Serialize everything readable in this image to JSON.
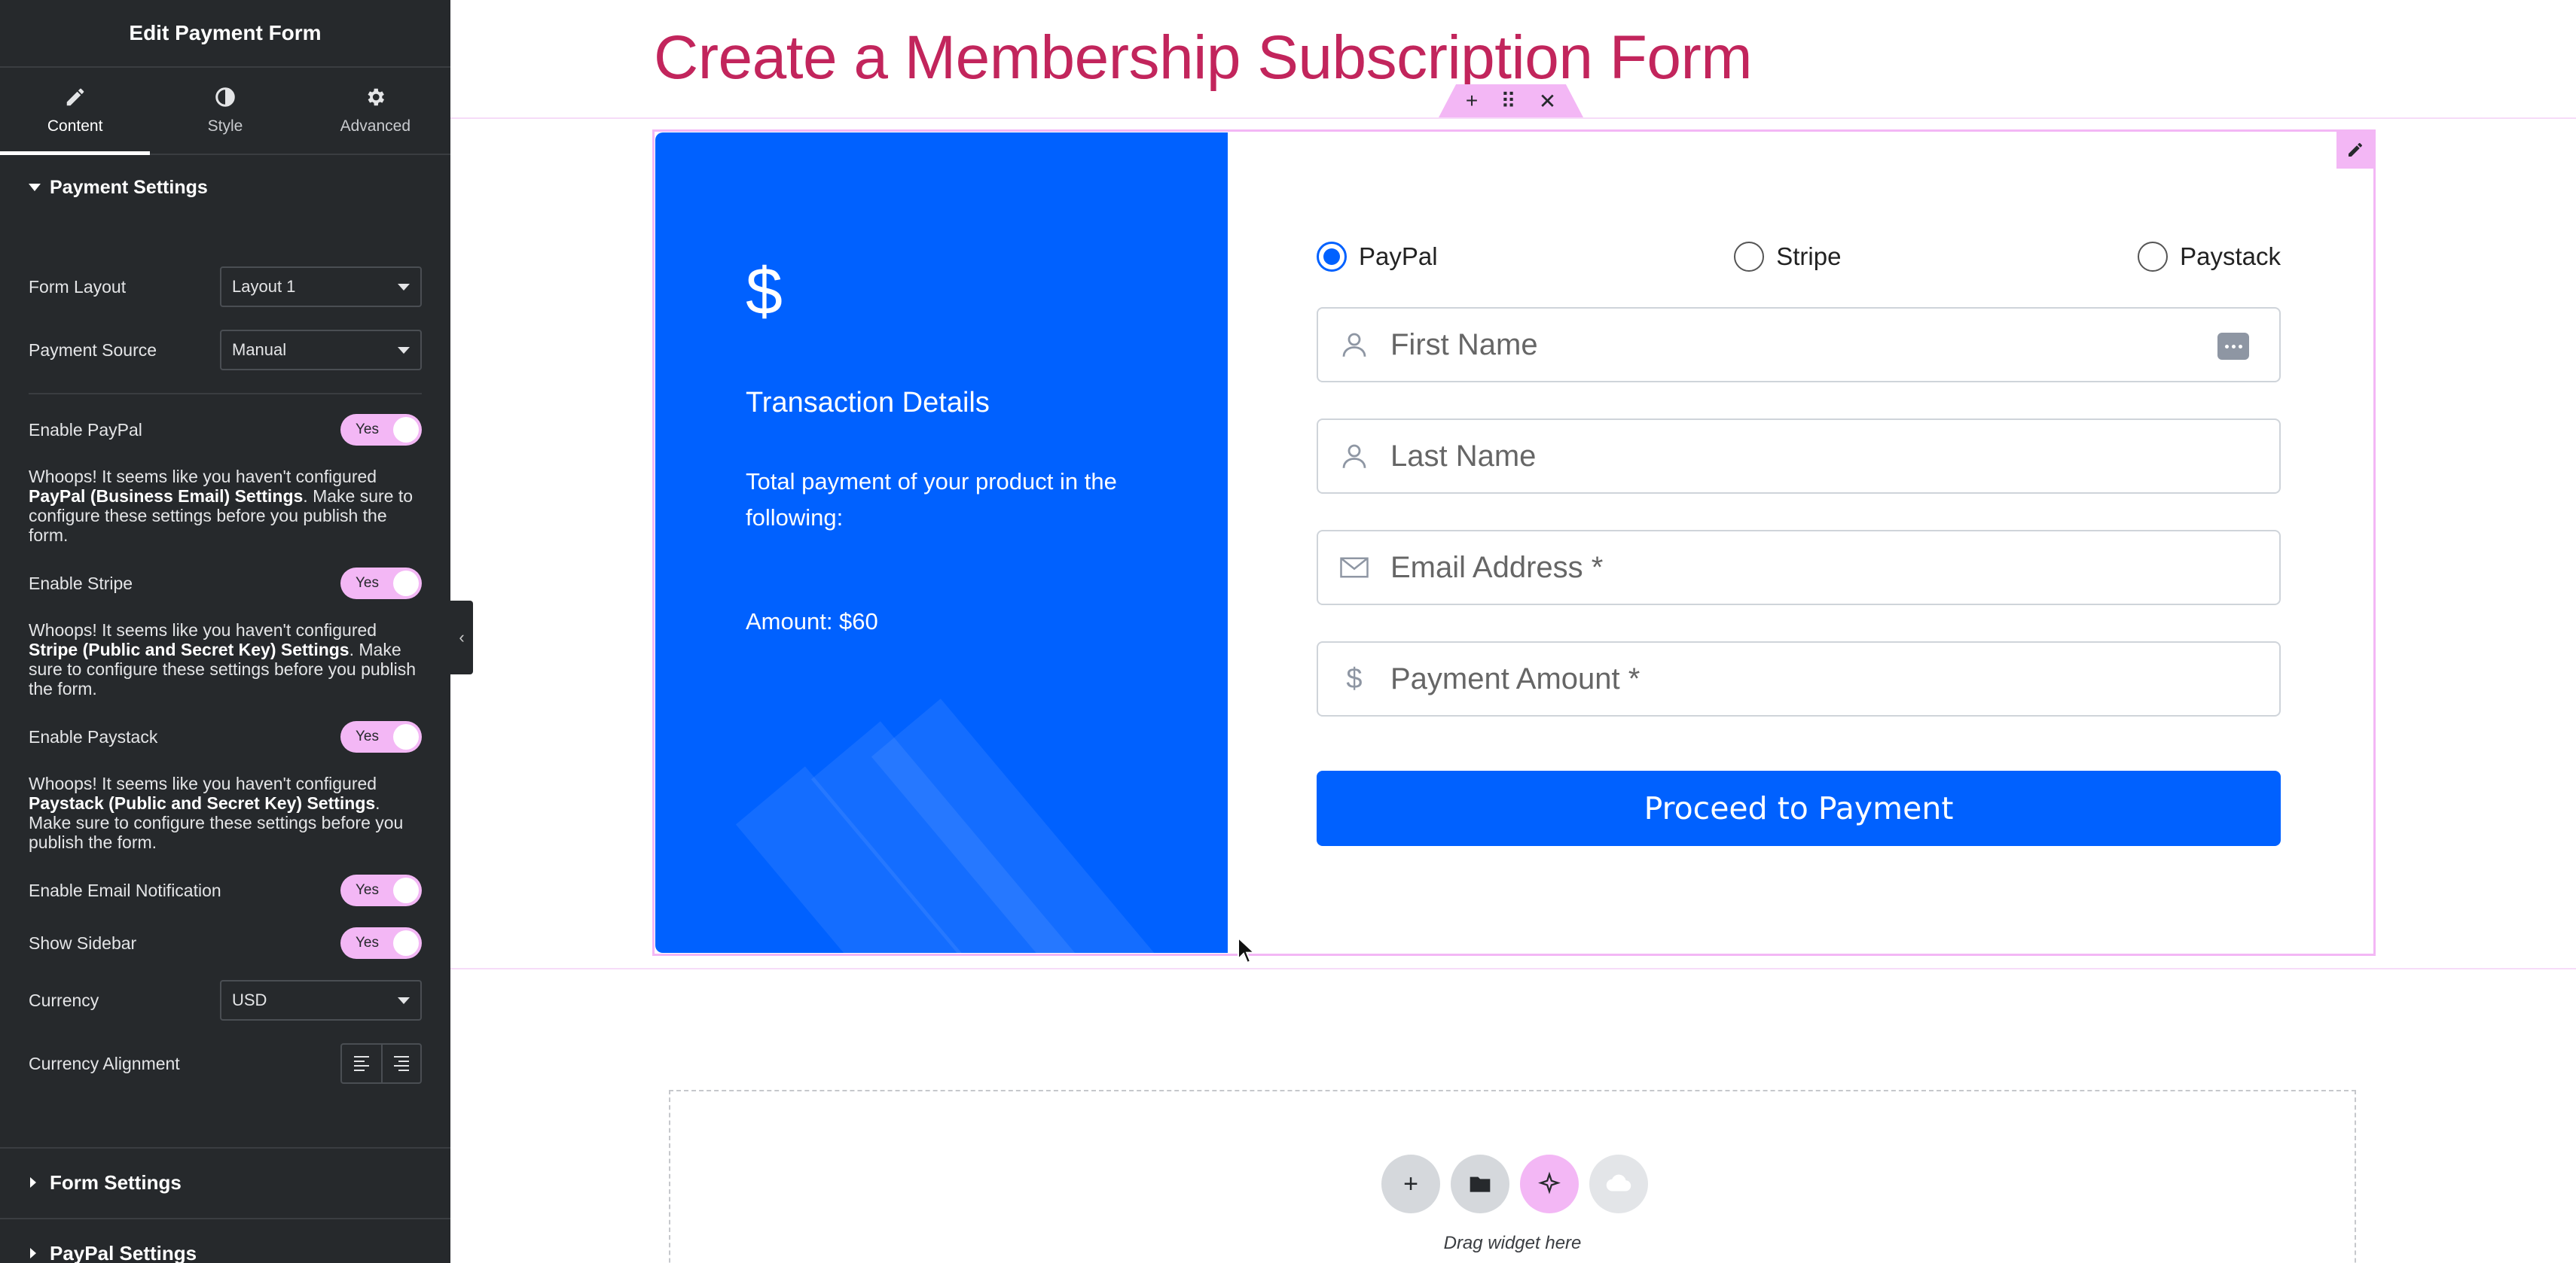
{
  "panel": {
    "header_title": "Edit Payment Form",
    "tabs": [
      {
        "label": "Content",
        "icon": "pencil-icon",
        "active": true
      },
      {
        "label": "Style",
        "icon": "half-circle-icon",
        "active": false
      },
      {
        "label": "Advanced",
        "icon": "gear-icon",
        "active": false
      }
    ],
    "payment_settings_title": "Payment Settings",
    "form_layout": {
      "label": "Form Layout",
      "value": "Layout 1"
    },
    "payment_source": {
      "label": "Payment Source",
      "value": "Manual"
    },
    "enable_paypal": {
      "label": "Enable PayPal",
      "value": "Yes"
    },
    "paypal_note": {
      "pre": "Whoops! It seems like you haven't configured ",
      "bold": "PayPal (Business Email) Settings",
      "post": ". Make sure to configure these settings before you publish the form."
    },
    "enable_stripe": {
      "label": "Enable Stripe",
      "value": "Yes"
    },
    "stripe_note": {
      "pre": "Whoops! It seems like you haven't configured ",
      "bold": "Stripe (Public and Secret Key) Settings",
      "post": ". Make sure to configure these settings before you publish the form."
    },
    "enable_paystack": {
      "label": "Enable Paystack",
      "value": "Yes"
    },
    "paystack_note": {
      "pre": "Whoops! It seems like you haven't configured ",
      "bold": "Paystack (Public and Secret Key) Settings",
      "post": ". Make sure to configure these settings before you publish the form."
    },
    "enable_email_notification": {
      "label": "Enable Email Notification",
      "value": "Yes"
    },
    "show_sidebar": {
      "label": "Show Sidebar",
      "value": "Yes"
    },
    "currency": {
      "label": "Currency",
      "value": "USD"
    },
    "currency_alignment": {
      "label": "Currency Alignment"
    },
    "form_settings_title": "Form Settings",
    "paypal_settings_title": "PayPal Settings"
  },
  "canvas": {
    "page_title": "Create a Membership Subscription Form",
    "handle": {
      "add": "+",
      "move": "⠿",
      "close": "✕"
    },
    "sidebar_card": {
      "currency_symbol": "$",
      "title": "Transaction Details",
      "description": "Total payment of your product in the following:",
      "amount": "Amount: $60"
    },
    "payment_methods": [
      {
        "label": "PayPal",
        "checked": true
      },
      {
        "label": "Stripe",
        "checked": false
      },
      {
        "label": "Paystack",
        "checked": false
      }
    ],
    "fields": {
      "first_name": {
        "placeholder": "First Name",
        "icon": "user-icon"
      },
      "last_name": {
        "placeholder": "Last Name",
        "icon": "user-icon"
      },
      "email": {
        "placeholder": "Email Address *",
        "icon": "envelope-icon"
      },
      "amount": {
        "placeholder": "Payment Amount *",
        "icon": "dollar-icon",
        "symbol": "$"
      }
    },
    "submit_label": "Proceed to Payment",
    "drop_zone_text": "Drag widget here"
  },
  "colors": {
    "accent_pink": "#f3b7f5",
    "title_color": "#c2255c",
    "primary_blue": "#0061ff",
    "panel_bg": "#26292c"
  }
}
